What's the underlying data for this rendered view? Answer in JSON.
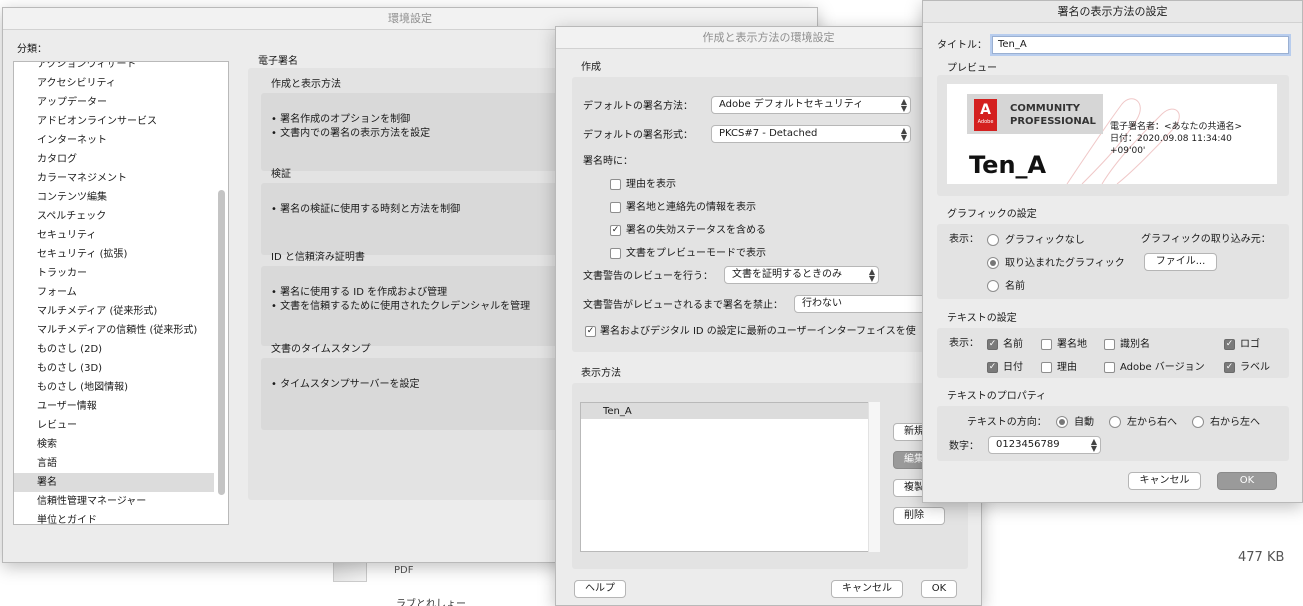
{
  "background": {
    "file_type": "PDF",
    "file_size": "477 KB",
    "truncated_text": "ラブとれしょー"
  },
  "prefs": {
    "title": "環境設定",
    "category_label": "分類：",
    "categories": [
      "アクションウィザード",
      "アクセシビリティ",
      "アップデーター",
      "アドビオンラインサービス",
      "インターネット",
      "カタログ",
      "カラーマネジメント",
      "コンテンツ編集",
      "スペルチェック",
      "セキュリティ",
      "セキュリティ (拡張)",
      "トラッカー",
      "フォーム",
      "マルチメディア (従来形式)",
      "マルチメディアの信頼性 (従来形式)",
      "ものさし (2D)",
      "ものさし (3D)",
      "ものさし (地図情報)",
      "ユーザー情報",
      "レビュー",
      "検索",
      "言語",
      "署名",
      "信頼性管理マネージャー",
      "単位とガイド"
    ],
    "selected_category": "署名",
    "section_title": "電子署名",
    "sections": [
      {
        "title": "作成と表示方法",
        "lines": [
          "• 署名作成のオプションを制御",
          "• 文書内での署名の表示方法を設定"
        ]
      },
      {
        "title": "検証",
        "lines": [
          "• 署名の検証に使用する時刻と方法を制御"
        ]
      },
      {
        "title": "ID と信頼済み証明書",
        "lines": [
          "• 署名に使用する ID を作成および管理",
          "• 文書を信頼するために使用されたクレデンシャルを管理"
        ]
      },
      {
        "title": "文書のタイムスタンプ",
        "lines": [
          "• タイムスタンプサーバーを設定"
        ]
      }
    ]
  },
  "creation": {
    "title": "作成と表示方法の環境設定",
    "group_create": "作成",
    "default_method_label": "デフォルトの署名方法：",
    "default_method_value": "Adobe デフォルトセキュリティ",
    "default_format_label": "デフォルトの署名形式：",
    "default_format_value": "PKCS#7 - Detached",
    "when_signing_label": "署名時に：",
    "checks": [
      {
        "label": "理由を表示",
        "checked": false
      },
      {
        "label": "署名地と連絡先の情報を表示",
        "checked": false
      },
      {
        "label": "署名の失効ステータスを含める",
        "checked": true
      },
      {
        "label": "文書をプレビューモードで表示",
        "checked": false
      }
    ],
    "review_warn_label": "文書警告のレビューを行う：",
    "review_warn_value": "文書を証明するときのみ",
    "prevent_label": "文書警告がレビューされるまで署名を禁止：",
    "prevent_value": "行わない",
    "latest_ui_label": "署名およびデジタル ID の設定に最新のユーザーインターフェイスを使",
    "latest_ui_checked": true,
    "group_display": "表示方法",
    "appearances": [
      "Ten_A"
    ],
    "side_buttons": [
      "新規",
      "編集",
      "複製",
      "削除"
    ],
    "help": "ヘルプ",
    "cancel": "キャンセル",
    "ok": "OK"
  },
  "appearance": {
    "title": "署名の表示方法の設定",
    "title_label": "タイトル：",
    "title_value": "Ten_A",
    "preview_label": "プレビュー",
    "preview": {
      "logo_letter": "A",
      "logo_small": "Adobe",
      "badge_line1": "COMMUNITY",
      "badge_line2": "PROFESSIONAL",
      "signer_name": "Ten_A",
      "detail_line1": "電子署名者：<あなたの共通名>",
      "detail_line2": "日付：2020.09.08 11:34:40",
      "detail_line3": "+09'00'"
    },
    "graphic_section": "グラフィックの設定",
    "display_label": "表示：",
    "graphic_options": [
      "グラフィックなし",
      "取り込まれたグラフィック",
      "名前"
    ],
    "graphic_selected": 1,
    "import_from_label": "グラフィックの取り込み元：",
    "file_button": "ファイル...",
    "text_section": "テキストの設定",
    "text_display_label": "表示：",
    "text_items": [
      {
        "label": "名前",
        "checked": true
      },
      {
        "label": "署名地",
        "checked": false
      },
      {
        "label": "識別名",
        "checked": false
      },
      {
        "label": "ロゴ",
        "checked": true
      },
      {
        "label": "日付",
        "checked": true
      },
      {
        "label": "理由",
        "checked": false
      },
      {
        "label": "Adobe バージョン",
        "checked": false
      },
      {
        "label": "ラベル",
        "checked": true
      }
    ],
    "props_section": "テキストのプロパティ",
    "direction_label": "テキストの方向：",
    "directions": [
      "自動",
      "左から右へ",
      "右から左へ"
    ],
    "direction_selected": 0,
    "digits_label": "数字：",
    "digits_value": "0123456789",
    "cancel": "キャンセル",
    "ok": "OK",
    "accent": "#d4201f"
  }
}
